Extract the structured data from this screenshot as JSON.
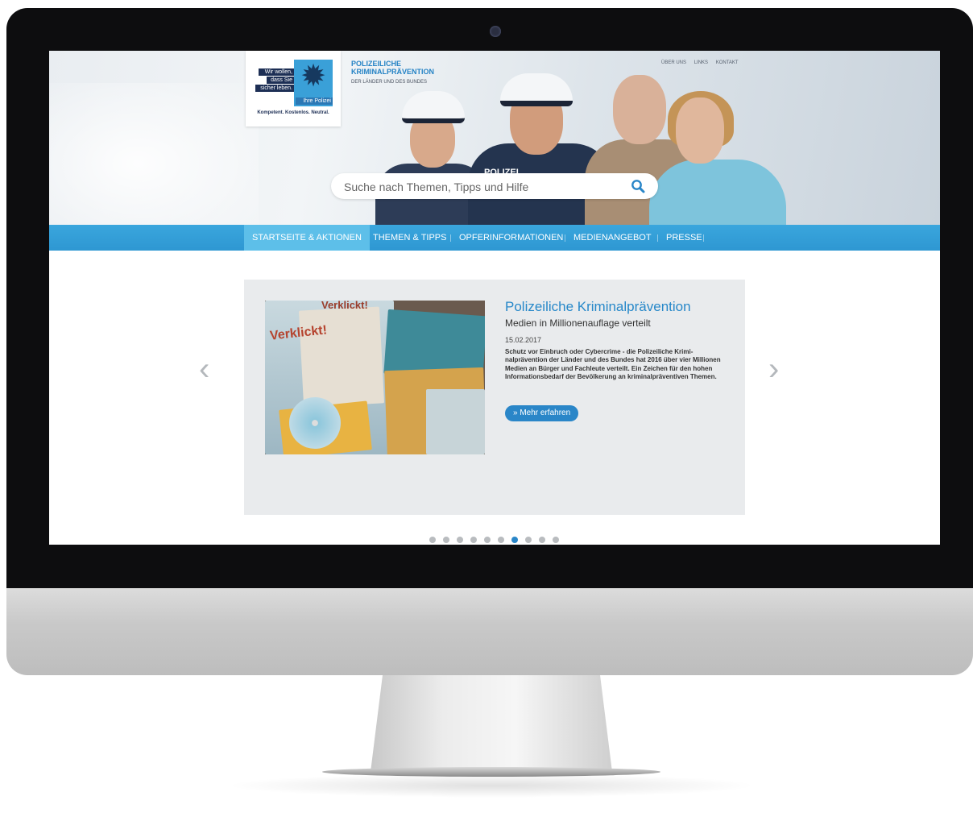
{
  "logo": {
    "line1": "Wir wollen,",
    "line2": "dass Sie",
    "line3": "sicher leben.",
    "line4": "Ihre Polizei",
    "tagline": "Kompetent. Kostenlos. Neutral."
  },
  "org": {
    "title_line1": "POLIZEILICHE",
    "title_line2": "KRIMINALPRÄVENTION",
    "subtitle": "DER LÄNDER UND DES BUNDES"
  },
  "topnav": [
    "ÜBER UNS",
    "LINKS",
    "KONTAKT"
  ],
  "search": {
    "placeholder": "Suche nach Themen, Tipps und Hilfe",
    "icon": "search-icon"
  },
  "hero": {
    "badge": "POLIZEI"
  },
  "nav": [
    "STARTSEITE & AKTIONEN",
    "THEMEN & TIPPS",
    "OPFERINFORMATIONEN",
    "MEDIENANGEBOT",
    "PRESSE"
  ],
  "slide": {
    "title": "Polizeiliche Kriminalprävention",
    "subtitle": "Medien in Millionenauflage verteilt",
    "date": "15.02.2017",
    "text": "Schutz vor Einbruch oder Cybercrime - die Polizeiliche Krimi-nalprävention der Länder und des Bundes hat 2016 über vier Millionen Medien an Bürger und Fachleute verteilt. Ein Zeichen für den hohen Informationsbedarf der Bevölkerung an kriminalpräventiven Themen.",
    "button": "» Mehr erfahren",
    "image_text": "Verklickt!"
  },
  "carousel": {
    "count": 10,
    "active": 7,
    "prev": "‹",
    "next": "›"
  },
  "colors": {
    "brand_blue": "#2e97d2",
    "active_nav": "#5dbfe9",
    "button_blue": "#2a86c8"
  }
}
